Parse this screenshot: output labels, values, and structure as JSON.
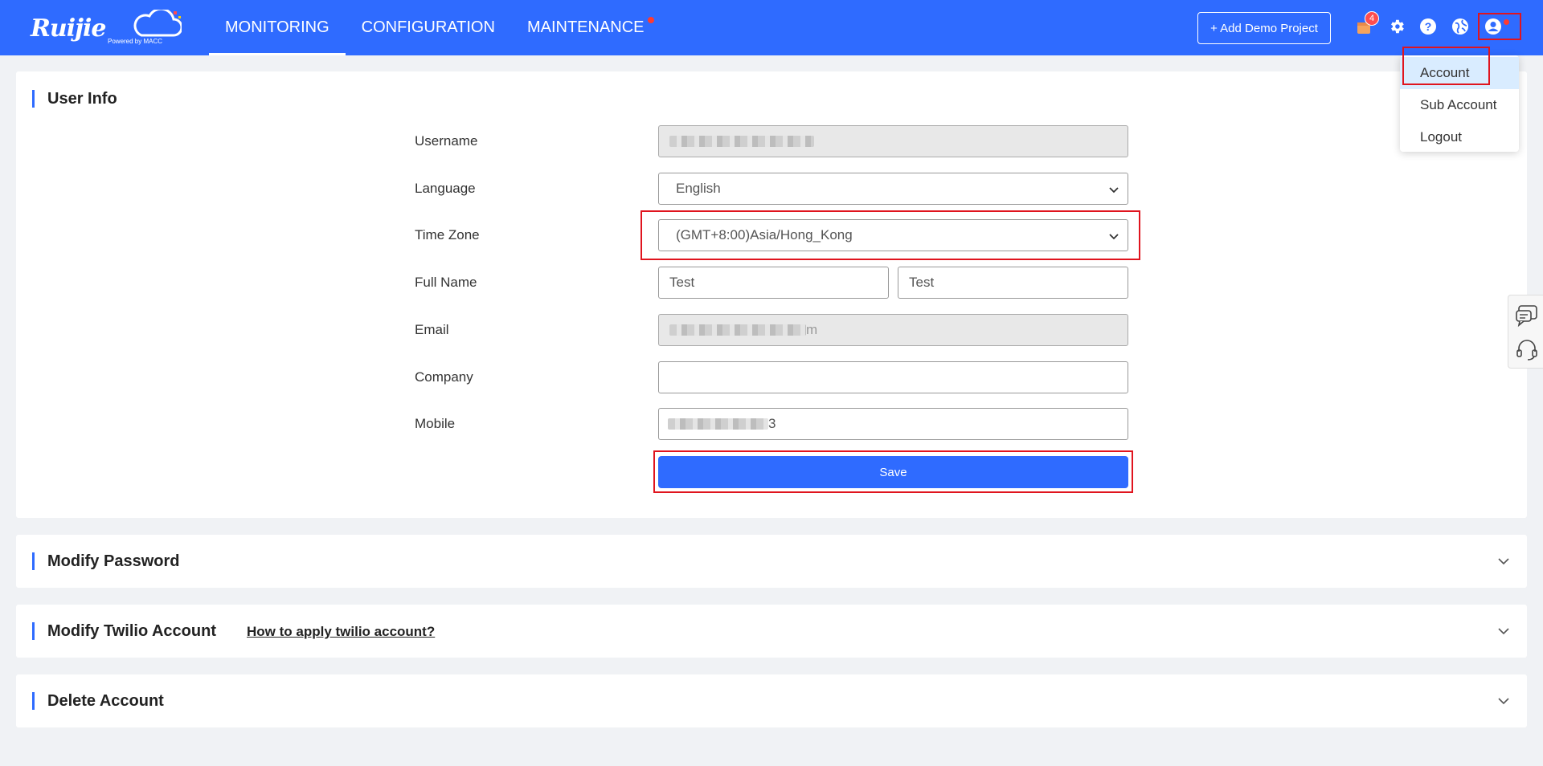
{
  "header": {
    "logo_text": "Ruijie",
    "logo_powered": "Powered by MACC",
    "nav": [
      {
        "label": "MONITORING",
        "active": true
      },
      {
        "label": "CONFIGURATION",
        "active": false
      },
      {
        "label": "MAINTENANCE",
        "active": false
      }
    ],
    "demo_button": "+ Add Demo Project",
    "notification_count": "4",
    "icons": [
      "notification-icon",
      "gear-icon",
      "help-icon",
      "globe-icon",
      "user-icon"
    ]
  },
  "account_menu": {
    "items": [
      {
        "label": "Account",
        "active": true
      },
      {
        "label": "Sub Account",
        "active": false
      },
      {
        "label": "Logout",
        "active": false
      }
    ]
  },
  "user_info": {
    "title": "User Info",
    "labels": {
      "username": "Username",
      "language": "Language",
      "timezone": "Time Zone",
      "fullname": "Full Name",
      "email": "Email",
      "company": "Company",
      "mobile": "Mobile"
    },
    "values": {
      "language": "English",
      "timezone": "(GMT+8:00)Asia/Hong_Kong",
      "first_name": "Test",
      "last_name": "Test",
      "email_suffix": "m",
      "company": "",
      "mobile_suffix": "3"
    },
    "save_label": "Save"
  },
  "sections": {
    "modify_password": "Modify Password",
    "modify_twilio": "Modify Twilio Account",
    "twilio_link": "How to apply twilio account?",
    "delete_account": "Delete Account"
  },
  "colors": {
    "brand": "#2f6bff",
    "highlight": "#e0141e",
    "badge": "#ff4d4f",
    "menu_active": "#d9ecff"
  }
}
